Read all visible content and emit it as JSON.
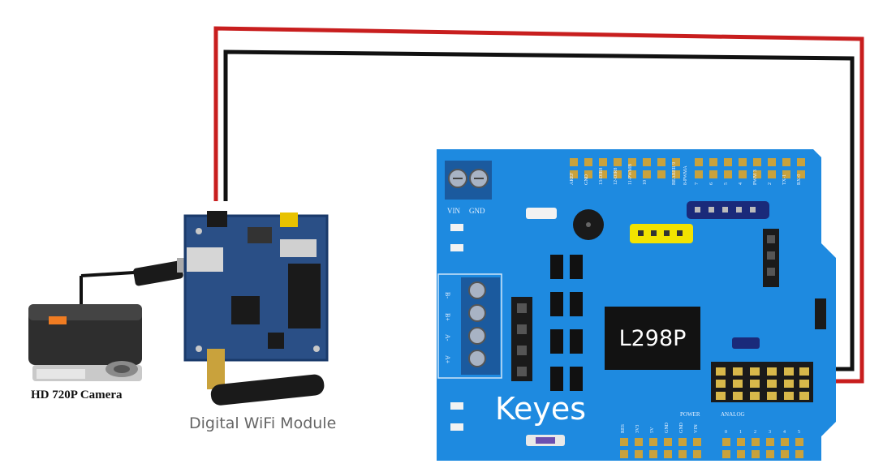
{
  "camera": {
    "label": "HD 720P Camera"
  },
  "wifi_module": {
    "label": "Digital WiFi Module"
  },
  "shield": {
    "brand": "Keyes",
    "chip": "L298P",
    "terminal_left": "VIN",
    "terminal_right": "GND",
    "motor_pins": [
      "B-",
      "B+",
      "A-",
      "A+"
    ],
    "top_header_labels": [
      "AREF",
      "GND",
      "13-DIR8",
      "12-DIR8",
      "11-PWMB",
      "10",
      "BEARER 9",
      "8-PWMA",
      "7",
      "6",
      "5",
      "4",
      "PWM 3",
      "2",
      "TX-1",
      "RX-0"
    ],
    "power_label": "POWER",
    "power_pins": [
      "RES",
      "3V3",
      "5V",
      "GND",
      "GND",
      "VIN"
    ],
    "analog_label": "ANALOG",
    "analog_pins": [
      "0",
      "1",
      "2",
      "3",
      "4",
      "5"
    ]
  },
  "colors": {
    "board_blue": "#1e8ae0",
    "wire_red": "#c81e1e",
    "wire_black": "#111111",
    "header_yellow": "#f2e300"
  }
}
